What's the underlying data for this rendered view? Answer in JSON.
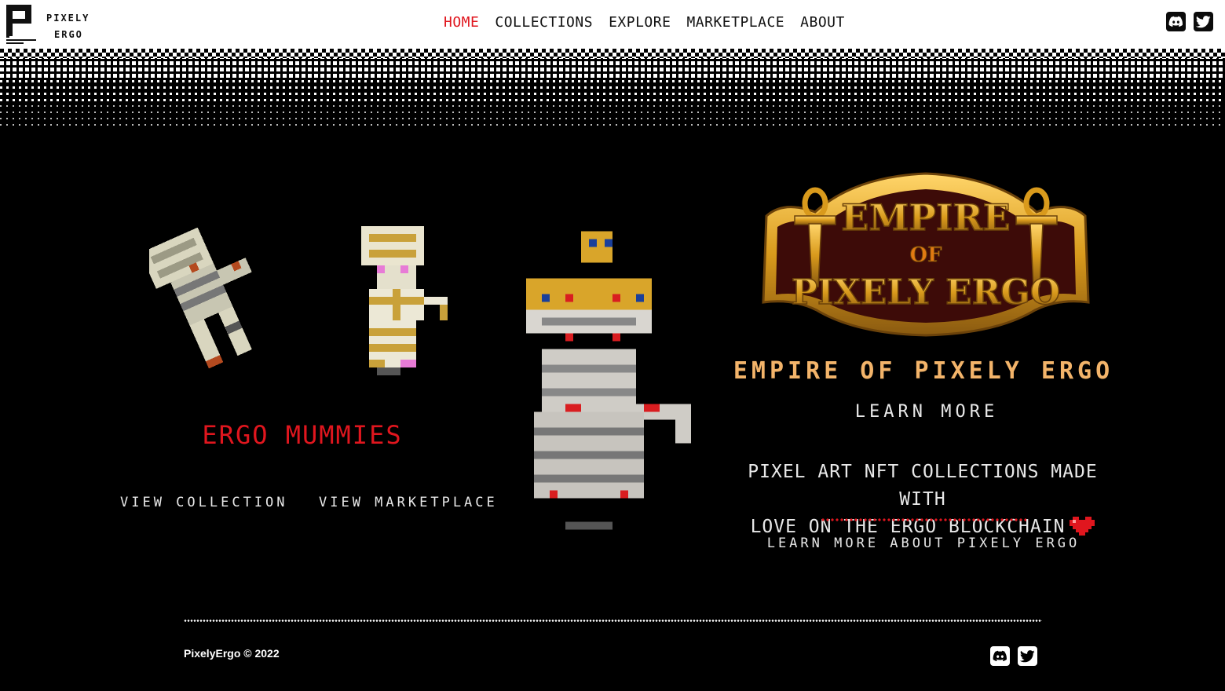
{
  "brand": {
    "line1": "PIXELY",
    "line2": "ERGO",
    "mark_small": "PIXELY ERGO"
  },
  "nav": [
    {
      "label": "HOME",
      "active": true
    },
    {
      "label": "COLLECTIONS",
      "active": false
    },
    {
      "label": "EXPLORE",
      "active": false
    },
    {
      "label": "MARKETPLACE",
      "active": false
    },
    {
      "label": "ABOUT",
      "active": false
    }
  ],
  "social": {
    "discord_icon": "discord-icon",
    "twitter_icon": "twitter-icon"
  },
  "collection": {
    "title": "ERGO MUMMIES",
    "view_collection": "VIEW COLLECTION",
    "view_marketplace": "VIEW MARKETPLACE"
  },
  "featured": {
    "emblem_line1": "EMPIRE",
    "emblem_line2": "OF",
    "emblem_line3": "PIXELY ERGO",
    "title": "EMPIRE OF PIXELY ERGO",
    "learn_more": "LEARN MORE"
  },
  "about": {
    "tagline_line1": "PIXEL ART NFT COLLECTIONS MADE WITH",
    "tagline_line2": "LOVE ON THE ERGO BLOCKCHAIN",
    "link": "LEARN MORE ABOUT PIXELY ERGO"
  },
  "footer": {
    "copyright": "PixelyErgo © 2022"
  },
  "colors": {
    "accent": "#e0161e",
    "gold": "#f3b46a",
    "background": "#000000",
    "text": "#e8e8e8"
  }
}
